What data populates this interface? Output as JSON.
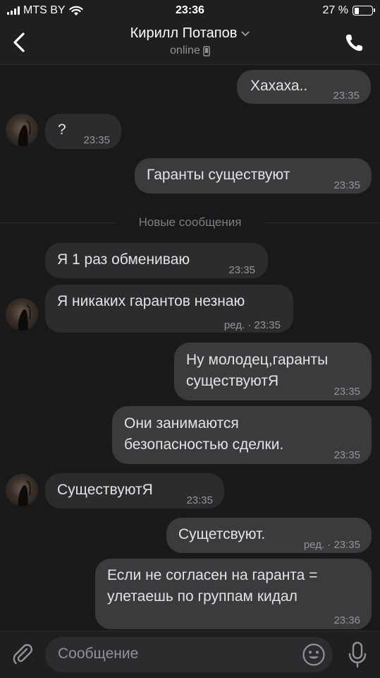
{
  "status_bar": {
    "carrier": "MTS BY",
    "time": "23:36",
    "battery": "27 %",
    "battery_level": 0.27
  },
  "header": {
    "name": "Кирилл Потапов",
    "status": "online"
  },
  "divider": {
    "label": "Новые сообщения"
  },
  "messages": [
    {
      "dir": "out",
      "lines": [
        "Хахаха.."
      ],
      "time": "23:35"
    },
    {
      "dir": "in",
      "lines": [
        "?"
      ],
      "time": "23:35"
    },
    {
      "dir": "out",
      "lines": [
        "Гаранты существуют"
      ],
      "time": "23:35"
    },
    {
      "dir": "in",
      "lines": [
        "Я 1 раз обмениваю"
      ],
      "time": "23:35"
    },
    {
      "dir": "in",
      "lines": [
        "Я никаких гарантов незнаю"
      ],
      "time": "ред. · 23:35"
    },
    {
      "dir": "out",
      "lines": [
        "Ну молодец,гаранты",
        "существуютЯ"
      ],
      "time": "23:35"
    },
    {
      "dir": "out",
      "lines": [
        "Они занимаются",
        "безопасностью сделки."
      ],
      "time": "23:35"
    },
    {
      "dir": "in",
      "lines": [
        "СуществуютЯ"
      ],
      "time": "23:35"
    },
    {
      "dir": "out",
      "lines": [
        "Сущетсвуют."
      ],
      "time": "ред. · 23:35"
    },
    {
      "dir": "out",
      "lines": [
        "Если не согласен на гаранта =",
        "улетаешь по группам кидал"
      ],
      "time": "23:36"
    }
  ],
  "composer": {
    "placeholder": "Сообщение"
  },
  "colors": {
    "background": "#19191a",
    "bubble_in": "#2c2c2e",
    "bubble_out": "#3b3b3d",
    "text": "#e1e3e6",
    "meta": "#939599"
  },
  "icons": [
    "back-chevron-icon",
    "chevron-down-icon",
    "mobile-device-icon",
    "phone-icon",
    "paperclip-icon",
    "smile-icon",
    "microphone-icon",
    "wifi-icon",
    "signal-icon",
    "battery-icon"
  ]
}
